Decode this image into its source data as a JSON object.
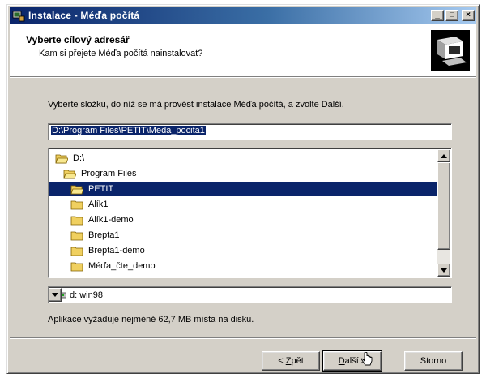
{
  "window": {
    "title": "Instalace - Méďa počítá",
    "minimize": "_",
    "maximize": "□",
    "close": "×"
  },
  "header": {
    "title": "Vyberte cílový adresář",
    "subtitle": "Kam si přejete Méďa počítá nainstalovat?"
  },
  "instruction": "Vyberte složku, do níž se má provést instalace Méďa počítá, a zvolte Další.",
  "path": {
    "value": "D:\\Program Files\\PETIT\\Meda_pocita1"
  },
  "folders": [
    {
      "label": "D:\\",
      "open": true
    },
    {
      "label": "Program Files",
      "open": true
    },
    {
      "label": "PETIT",
      "open": true,
      "selected": true
    },
    {
      "label": "Alík1",
      "open": false
    },
    {
      "label": "Alík1-demo",
      "open": false
    },
    {
      "label": "Brepta1",
      "open": false
    },
    {
      "label": "Brepta1-demo",
      "open": false
    },
    {
      "label": "Méďa_čte_demo",
      "open": false
    }
  ],
  "drive": {
    "value": "d: win98"
  },
  "space_info": "Aplikace vyžaduje nejméně 62,7 MB místa na disku.",
  "buttons": {
    "back": {
      "prefix": "< ",
      "mnemonic": "Z",
      "rest": "pět"
    },
    "next": {
      "mnemonic": "D",
      "rest": "alší >"
    },
    "cancel": "Storno"
  },
  "colors": {
    "selection": "#0a246a",
    "face": "#d4d0c8",
    "folder": "#f0d060"
  }
}
